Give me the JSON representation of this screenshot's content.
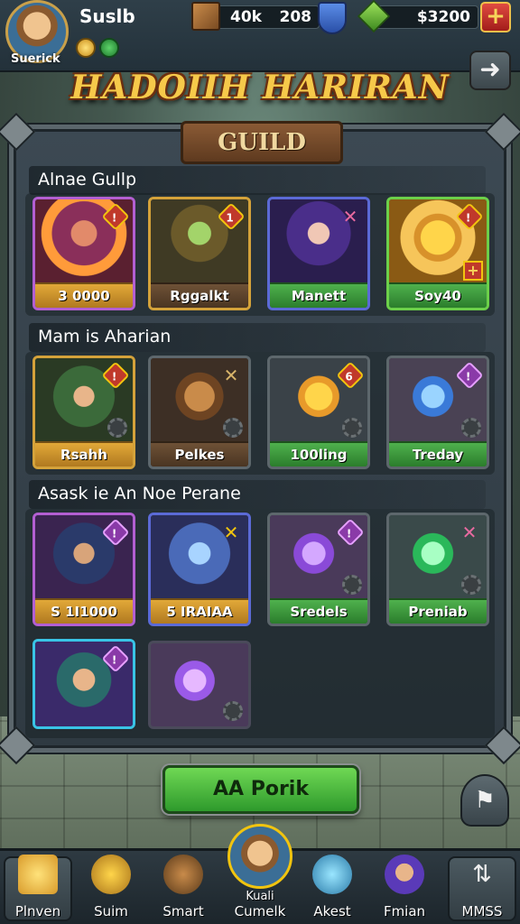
{
  "player": {
    "name_top": "Suslb",
    "name_bottom": "Suerick"
  },
  "resources": {
    "count_a": "40k",
    "count_b": "208",
    "gold": "$3200",
    "add_label": "+"
  },
  "title": "HADOIIH HARIRAN",
  "panel": {
    "banner": "GUILD"
  },
  "sections": [
    {
      "title": "Alnae Gullp",
      "cards": [
        {
          "label": "3 0000",
          "style": "gold"
        },
        {
          "label": "Rggalkt",
          "style": "brown"
        },
        {
          "label": "Manett",
          "style": "green"
        },
        {
          "label": "Soy40",
          "style": "green"
        }
      ]
    },
    {
      "title": "Mam is Aharian",
      "cards": [
        {
          "label": "Rsahh",
          "style": "gold"
        },
        {
          "label": "Pelkes",
          "style": "brown"
        },
        {
          "label": "100ling",
          "style": "green"
        },
        {
          "label": "Treday",
          "style": "green"
        }
      ]
    },
    {
      "title": "Asask ie An Noe Perane",
      "cards": [
        {
          "label": "S 1I1000",
          "style": "gold"
        },
        {
          "label": "5 IRAIAA",
          "style": "gold"
        },
        {
          "label": "Sredels",
          "style": "green"
        },
        {
          "label": "Preniab",
          "style": "green"
        }
      ]
    }
  ],
  "main_button": "AA Porik",
  "nav": [
    {
      "label": "Plnven",
      "icon": "cheese-icon"
    },
    {
      "label": "Suim",
      "icon": "bell-icon"
    },
    {
      "label": "Smart",
      "icon": "gear-robot-icon"
    },
    {
      "label_top": "Kuali",
      "label": "Cumelk",
      "icon": "hero-portrait-icon"
    },
    {
      "label": "Akest",
      "icon": "crystal-icon"
    },
    {
      "label": "Fmian",
      "icon": "character-icon"
    },
    {
      "label": "MMSS",
      "icon": "stats-icon"
    }
  ]
}
